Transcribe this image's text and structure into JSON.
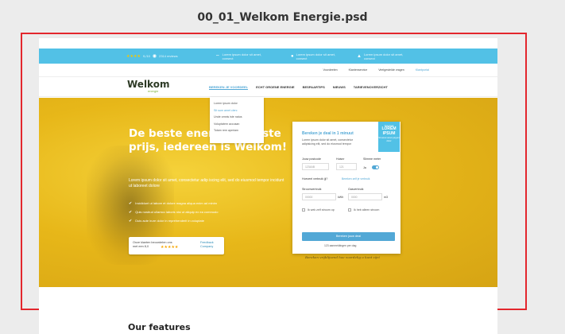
{
  "file_title": "00_01_Welkom Energie.psd",
  "topbar": {
    "rating": "9,/10",
    "reviews": "2314 reviews",
    "usp1": "Lorem ipsum dolor sit amet, consect",
    "usp2": "Lorem ipsum dolor sit amet, consect",
    "usp3": "Lorem ipsum dolor sit amet, consect"
  },
  "subnav": {
    "items": [
      "Voordeelen",
      "Klantenservice",
      "Veelgestelde vragen"
    ],
    "contact": "Klantportal"
  },
  "nav": {
    "logo": "Welkom",
    "logo_sub": "energie",
    "links": [
      "BEREKEN JE VOORDEEL",
      "ECHT GROENE ENERGIE",
      "BESPAARTIPS",
      "NIEUWS",
      "TARIEVENOVERZICHT"
    ]
  },
  "dropdown": {
    "items": [
      "Lorem ipsum dolor",
      "Sit sum amet clerc",
      "Unde omnis iste natus",
      "Voluptatem accusan",
      "Totam rem aperiam"
    ]
  },
  "hero": {
    "title": "De beste energi dé beste prijs, iedereen is Welkom!",
    "text": "Lorem ipsum dolor sit amet, consectetur adip iscing elit, sed do eiusmod tempor incidunt ut laboreet dolore",
    "checks": [
      "Incididunt ut labore et dolore magna aliqua enim ad minim",
      "Quis nostrud ullamco laboris nisi ut aliquip ex ea commodo",
      "Duis aute irure dolor in reprehenderit in voluptate"
    ],
    "badge_text": "Onze klanten beoordelen ons met een 8,0",
    "badge_fb": "Feedback Company"
  },
  "form": {
    "title": "Bereken je deal in 1 minuut",
    "sub": "Lorem ipsum dolor sit amet, consectetur adipisicing elit, sed do eiusmod tempor",
    "ribbon_top": "Speciaal",
    "ribbon_main": "LOREM IPSUM",
    "ribbon_bottom": "Sit amet amet jurgum dolor",
    "postcode_label": "Jouw postcode",
    "postcode_value": "1234AB",
    "house_label": "Huisnr",
    "house_value": "121",
    "meter_label": "Slimme meter",
    "meter_value": "Ja",
    "estimate_label": "Hoeveel verbruik jij?",
    "estimate_link": "Bereken zelf je verbruik",
    "power_label": "Stroomverbruik",
    "power_value": "00000",
    "power_unit": "kWh",
    "gas_label": "Gasverbruik",
    "gas_value": "0000",
    "gas_unit": "m3",
    "cb1": "Ik wek zelf stroom op",
    "cb2": "Ik heb alleen stroom",
    "button": "Bereken jouw deal",
    "note": "123 aanmeldingen per dag"
  },
  "handnote": "Bereken vrijblijvend hoe voordelig u kunt zijn!",
  "features_title": "Our features"
}
